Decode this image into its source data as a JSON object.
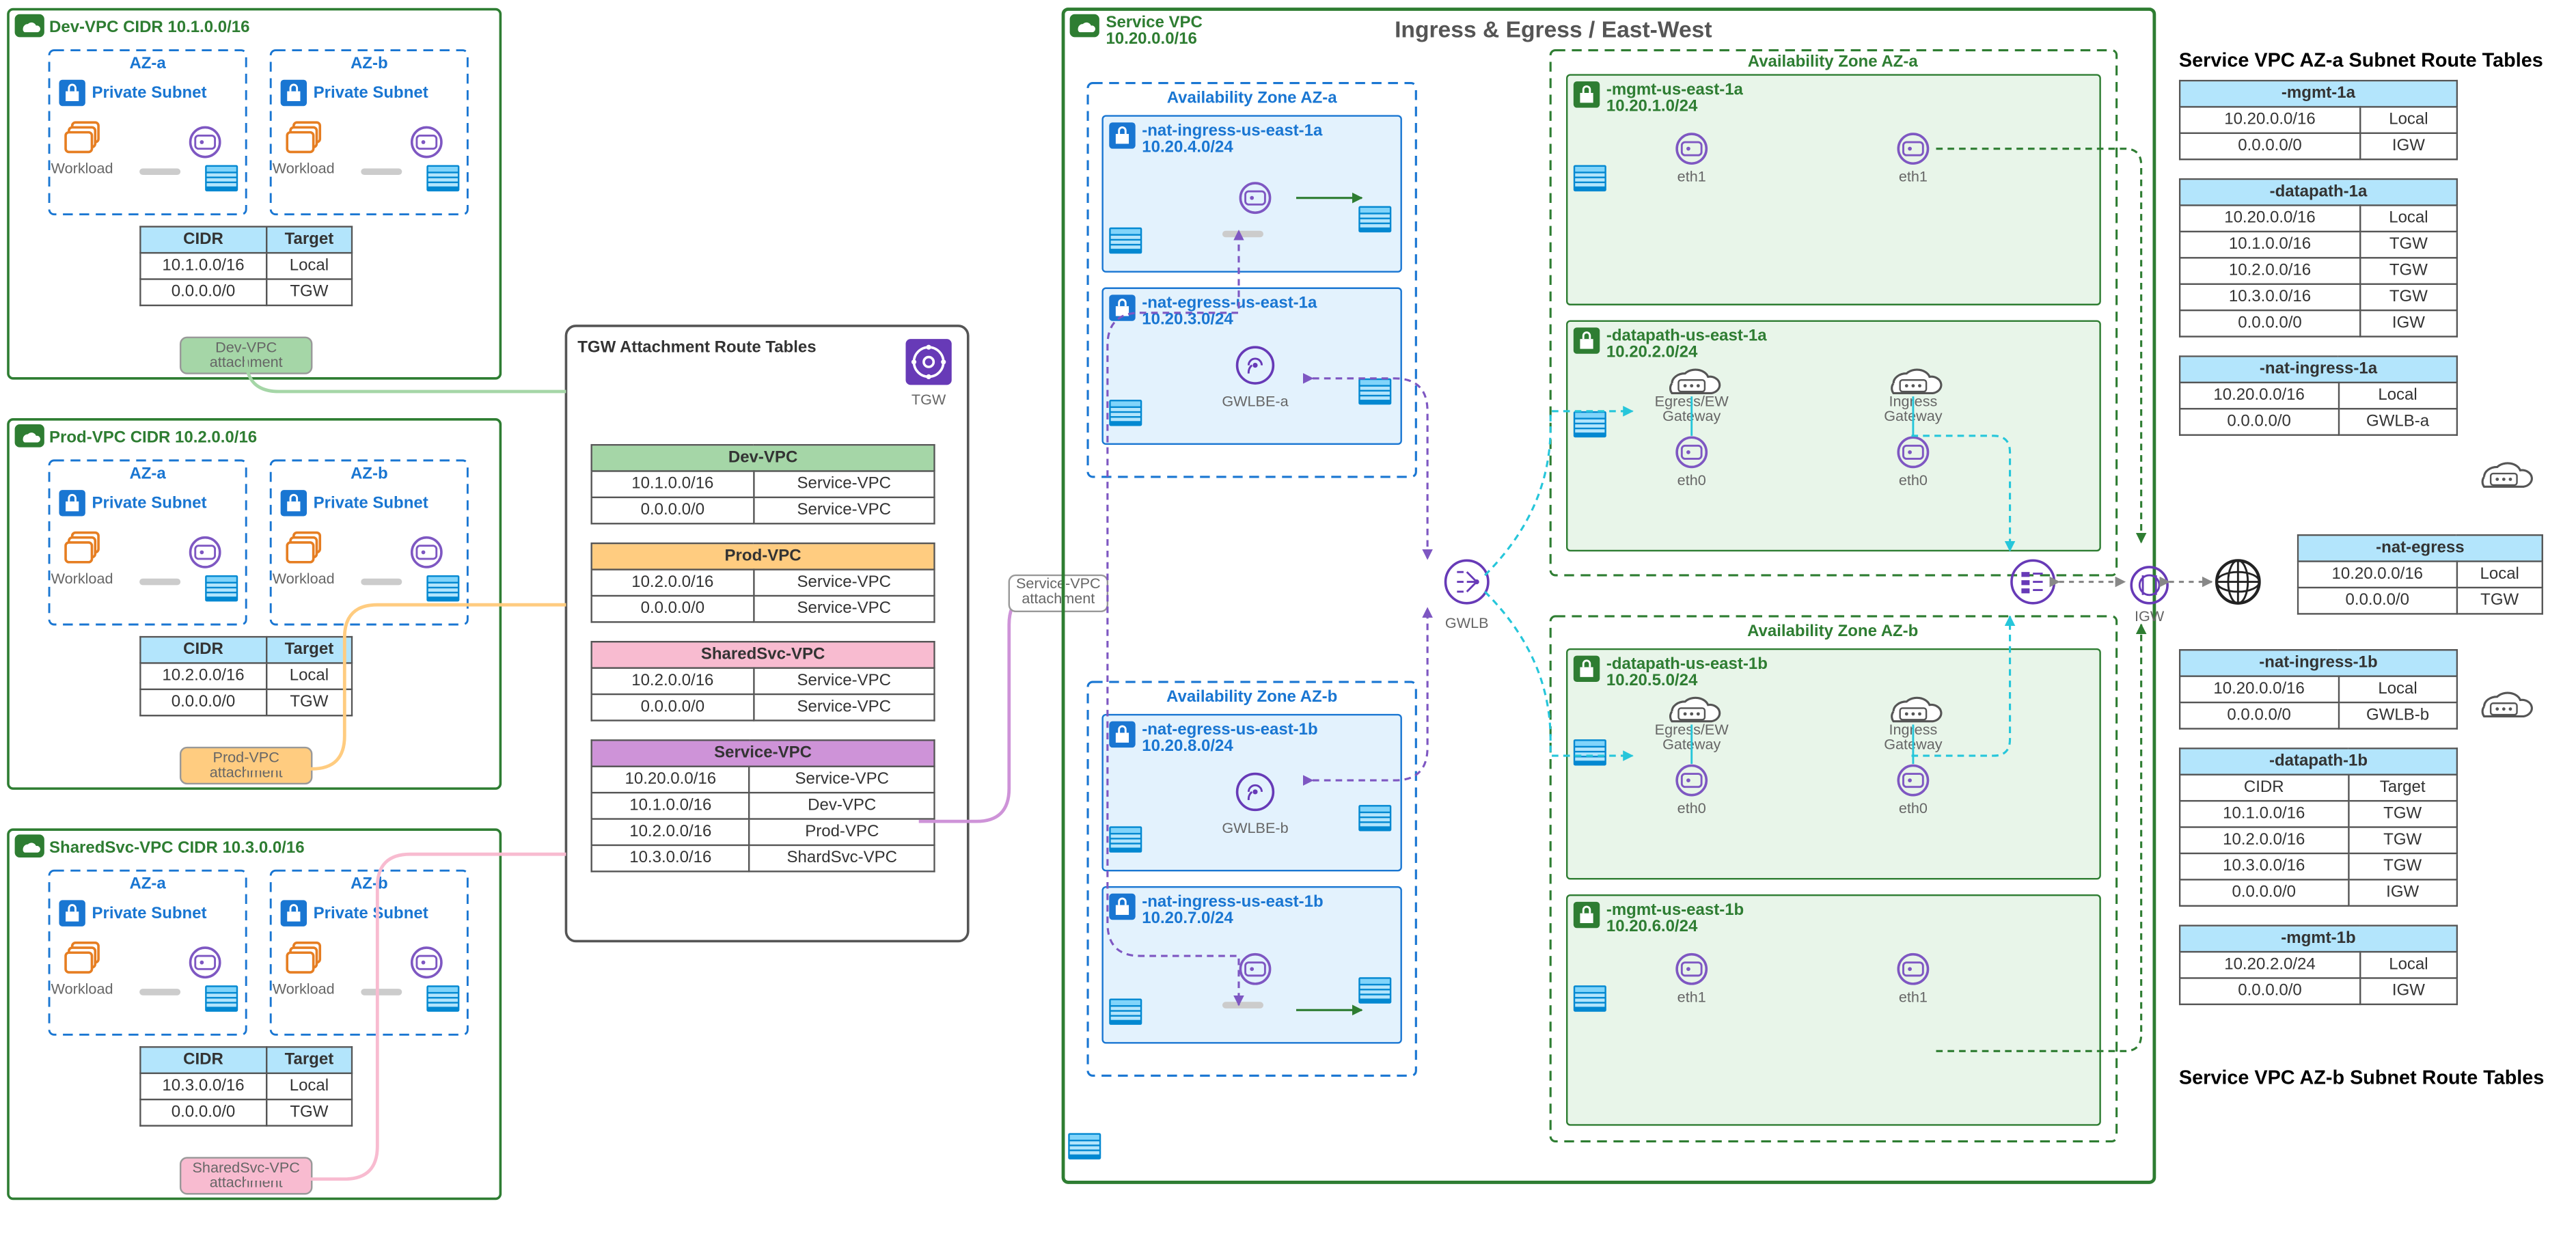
{
  "spoke_vpcs": [
    {
      "name": "Dev-VPC",
      "cidr": "CIDR 10.1.0.0/16",
      "rt": [
        [
          "CIDR",
          "Target"
        ],
        [
          "10.1.0.0/16",
          "Local"
        ],
        [
          "0.0.0.0/0",
          "TGW"
        ]
      ],
      "att": "Dev-VPC\nattachment",
      "color": "#a5d6a7"
    },
    {
      "name": "Prod-VPC",
      "cidr": "CIDR 10.2.0.0/16",
      "rt": [
        [
          "CIDR",
          "Target"
        ],
        [
          "10.2.0.0/16",
          "Local"
        ],
        [
          "0.0.0.0/0",
          "TGW"
        ]
      ],
      "att": "Prod-VPC\nattachment",
      "color": "#ffcc80"
    },
    {
      "name": "SharedSvc-VPC",
      "cidr": "CIDR 10.3.0.0/16",
      "rt": [
        [
          "CIDR",
          "Target"
        ],
        [
          "10.3.0.0/16",
          "Local"
        ],
        [
          "0.0.0.0/0",
          "TGW"
        ]
      ],
      "att": "SharedSvc-VPC\nattachment",
      "color": "#f8bbd0"
    }
  ],
  "spoke_az": [
    "AZ-a",
    "AZ-b"
  ],
  "spoke_subnet": "Private Subnet",
  "spoke_workload": "Workload",
  "tgw": {
    "title": "TGW Attachment Route Tables",
    "icon": "TGW",
    "tables": [
      {
        "name": "Dev-VPC",
        "color": "#a5d6a7",
        "rows": [
          [
            "10.1.0.0/16",
            "Service-VPC"
          ],
          [
            "0.0.0.0/0",
            "Service-VPC"
          ]
        ]
      },
      {
        "name": "Prod-VPC",
        "color": "#ffcc80",
        "rows": [
          [
            "10.2.0.0/16",
            "Service-VPC"
          ],
          [
            "0.0.0.0/0",
            "Service-VPC"
          ]
        ]
      },
      {
        "name": "SharedSvc-VPC",
        "color": "#f8bbd0",
        "rows": [
          [
            "10.2.0.0/16",
            "Service-VPC"
          ],
          [
            "0.0.0.0/0",
            "Service-VPC"
          ]
        ]
      },
      {
        "name": "Service-VPC",
        "color": "#ce93d8",
        "rows": [
          [
            "10.20.0.0/16",
            "Service-VPC"
          ],
          [
            "10.1.0.0/16",
            "Dev-VPC"
          ],
          [
            "10.2.0.0/16",
            "Prod-VPC"
          ],
          [
            "10.3.0.0/16",
            "ShardSvc-VPC"
          ]
        ]
      }
    ],
    "svc_att": "Service-VPC\nattachment"
  },
  "svc_vpc": {
    "name": "Service VPC",
    "cidr": "10.20.0.0/16",
    "heading": "Ingress & Egress / East-West",
    "az_a": "Availability Zone AZ-a",
    "az_b": "Availability Zone AZ-b",
    "subnets_a": [
      {
        "name": "-nat-ingress-us-east-1a",
        "cidr": "10.20.4.0/24"
      },
      {
        "name": "-nat-egress-us-east-1a",
        "cidr": "10.20.3.0/24",
        "label": "GWLBE-a"
      }
    ],
    "subnets_b": [
      {
        "name": "-nat-egress-us-east-1b",
        "cidr": "10.20.8.0/24",
        "label": "GWLBE-b"
      },
      {
        "name": "-nat-ingress-us-east-1b",
        "cidr": "10.20.7.0/24"
      }
    ],
    "fw_a": [
      {
        "name": "-mgmt-us-east-1a",
        "cidr": "10.20.1.0/24",
        "eth": "eth1"
      },
      {
        "name": "-datapath-us-east-1a",
        "cidr": "10.20.2.0/24",
        "eth": "eth0",
        "gw1": "Egress/EW\nGateway",
        "gw2": "Ingress\nGateway"
      }
    ],
    "fw_b": [
      {
        "name": "-datapath-us-east-1b",
        "cidr": "10.20.5.0/24",
        "eth": "eth0",
        "gw1": "Egress/EW\nGateway",
        "gw2": "Ingress\nGateway"
      },
      {
        "name": "-mgmt-us-east-1b",
        "cidr": "10.20.6.0/24",
        "eth": "eth1"
      }
    ],
    "gwlb": "GWLB",
    "igw": "IGW"
  },
  "svc_rt_a": {
    "title": "Service VPC AZ-a Subnet Route Tables",
    "tables": [
      {
        "name": "-mgmt-1a",
        "rows": [
          [
            "10.20.0.0/16",
            "Local"
          ],
          [
            "0.0.0.0/0",
            "IGW"
          ]
        ]
      },
      {
        "name": "-datapath-1a",
        "rows": [
          [
            "10.20.0.0/16",
            "Local"
          ],
          [
            "10.1.0.0/16",
            "TGW"
          ],
          [
            "10.2.0.0/16",
            "TGW"
          ],
          [
            "10.3.0.0/16",
            "TGW"
          ],
          [
            "0.0.0.0/0",
            "IGW"
          ]
        ]
      },
      {
        "name": "-nat-ingress-1a",
        "rows": [
          [
            "10.20.0.0/16",
            "Local"
          ],
          [
            "0.0.0.0/0",
            "GWLB-a"
          ]
        ]
      }
    ]
  },
  "svc_rt_eg": {
    "name": "-nat-egress",
    "rows": [
      [
        "10.20.0.0/16",
        "Local"
      ],
      [
        "0.0.0.0/0",
        "TGW"
      ]
    ]
  },
  "svc_rt_b": {
    "title": "Service VPC AZ-b Subnet Route Tables",
    "tables": [
      {
        "name": "-nat-ingress-1b",
        "rows": [
          [
            "10.20.0.0/16",
            "Local"
          ],
          [
            "0.0.0.0/0",
            "GWLB-b"
          ]
        ]
      },
      {
        "name": "-datapath-1b",
        "rows": [
          [
            "CIDR",
            "Target"
          ],
          [
            "10.1.0.0/16",
            "TGW"
          ],
          [
            "10.2.0.0/16",
            "TGW"
          ],
          [
            "10.3.0.0/16",
            "TGW"
          ],
          [
            "0.0.0.0/0",
            "IGW"
          ]
        ]
      },
      {
        "name": "-mgmt-1b",
        "rows": [
          [
            "10.20.2.0/24",
            "Local"
          ],
          [
            "0.0.0.0/0",
            "IGW"
          ]
        ]
      }
    ]
  }
}
